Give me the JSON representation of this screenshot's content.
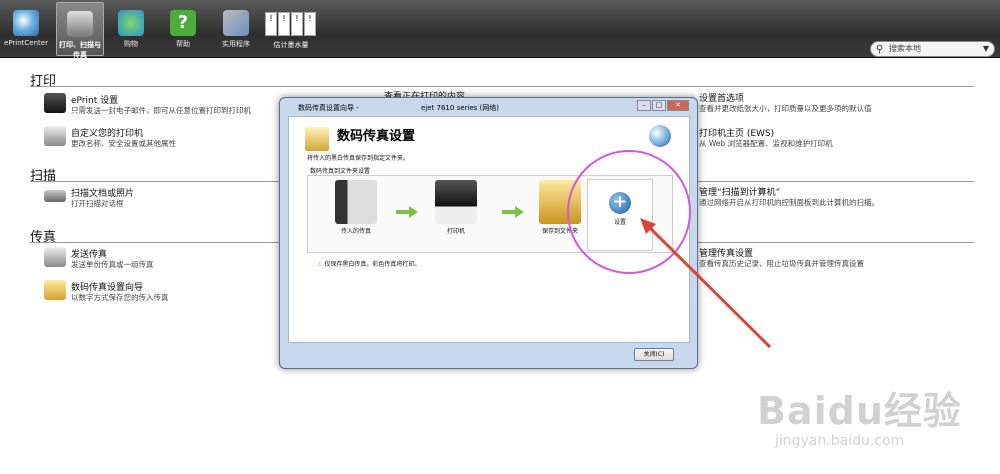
{
  "toolbar": {
    "buttons": [
      {
        "label": "ePrintCenter",
        "icon": "eprint-center-icon"
      },
      {
        "label": "打印、扫描与传真",
        "icon": "printer-icon"
      },
      {
        "label": "购物",
        "icon": "shopping-icon"
      },
      {
        "label": "帮助",
        "icon": "help-icon"
      },
      {
        "label": "实用程序",
        "icon": "tools-icon"
      }
    ],
    "ink": {
      "label": "估计墨水量",
      "marks": [
        "!",
        "!",
        "!",
        "!"
      ]
    },
    "search": {
      "placeholder": "搜索本地"
    }
  },
  "sections": {
    "print": {
      "heading": "打印",
      "items": [
        {
          "title": "ePrint 设置",
          "desc": "只需发送一封电子邮件，即可从任意位置打印到打印机"
        },
        {
          "title": "自定义您的打印机",
          "desc": "更改名称、安全设置或其他属性"
        },
        {
          "title": "查看正在打印的内容",
          "desc": ""
        },
        {
          "title": "设置首选项",
          "desc": "查看并更改纸张大小，打印质量以及更多项的默认值"
        },
        {
          "title": "打印机主页 (EWS)",
          "desc": "从 Web 浏览器配置、监视和维护打印机"
        }
      ]
    },
    "scan": {
      "heading": "扫描",
      "items": [
        {
          "title": "扫描文档或照片",
          "desc": "打开扫描对话框"
        },
        {
          "title": "管理“扫描到计算机”",
          "desc": "通过网络开启从打印机的控制面板到此计算机的扫描。"
        }
      ]
    },
    "fax": {
      "heading": "传真",
      "items": [
        {
          "title": "发送传真",
          "desc": "发送单份传真或一组传真"
        },
        {
          "title": "数码传真设置向导",
          "desc": "以数字方式保存您的传入传真"
        },
        {
          "title": "管理传真设置",
          "desc": "查看传真历史记录、阻止垃圾传真并管理传真设置"
        }
      ]
    }
  },
  "dialog": {
    "title": "数码传真设置向导 -",
    "title_tail": "ejet 7610 series (网络)",
    "heading": "数码传真设置",
    "subtitle": "将传入的黑白传真保存到指定文件夹。",
    "flow_caption": "数码传真到文件夹设置",
    "nodes": [
      "传入的传真",
      "打印机",
      "保存到文件夹"
    ],
    "settings_label": "设置",
    "warning": "仅保存黑白传真。彩色传真将打印。",
    "close_label": "关闭(C)"
  },
  "watermark": {
    "brand": "Baidu经验",
    "url": "jingyan.baidu.com"
  },
  "colors": {
    "annotation_circle": "#d25ad8",
    "annotation_arrow": "#d9453a",
    "flow_arrow": "#7dc242"
  }
}
